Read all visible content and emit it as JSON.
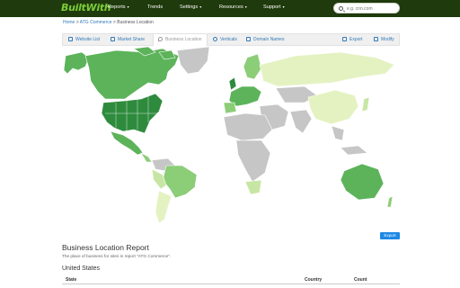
{
  "app": {
    "logo": "BuiltWith"
  },
  "topnav": [
    {
      "label": "Reports",
      "caret": "▾"
    },
    {
      "label": "Trends",
      "caret": ""
    },
    {
      "label": "Settings",
      "caret": "▾"
    },
    {
      "label": "Resources",
      "caret": "▾"
    },
    {
      "label": "Support",
      "caret": "▾"
    }
  ],
  "search": {
    "placeholder": "e.g. cnn.com",
    "value": ""
  },
  "breadcrumb": {
    "home": "Home",
    "sep1": " > ",
    "list": "ATG Commerce",
    "sep2": " > ",
    "current": "Business Location"
  },
  "tabs": {
    "website_list": "Website List",
    "market_share": "Market Share",
    "business_location": "Business Location",
    "verticals": "Verticals",
    "domain_names": "Domain Names",
    "export": "Export",
    "modify": "Modify"
  },
  "map": {
    "legend_colors": {
      "high": "#2e8b3d",
      "mid_high": "#5cb35a",
      "mid": "#8ccd78",
      "low": "#c7e6a4",
      "very_low": "#e4f2c2",
      "none": "#c6c6c6"
    }
  },
  "export_button": "Export",
  "report": {
    "title": "Business Location Report",
    "subtitle": "The place of business for sites in report \"ATG Commerce\".",
    "section": "United States",
    "columns": [
      "State",
      "Country",
      "Count"
    ]
  }
}
